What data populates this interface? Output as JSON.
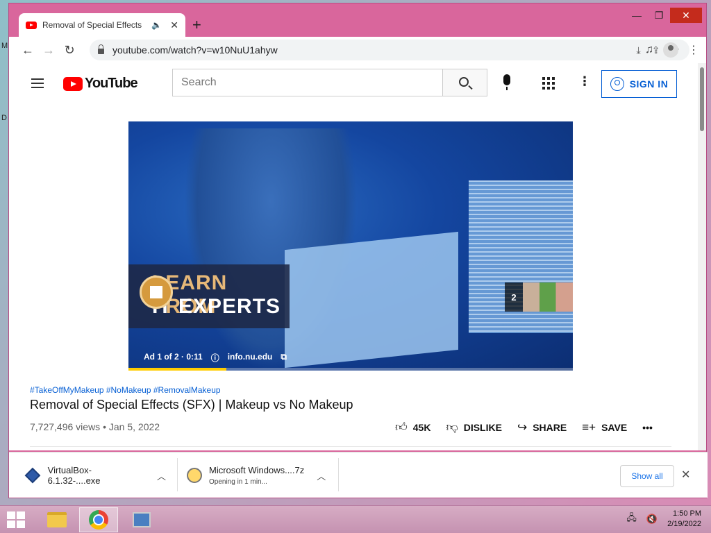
{
  "desktop": {
    "frag_top": "M",
    "frag_mid": "D"
  },
  "browser": {
    "tab_title": "Removal of Special Effects (SFX) | Makeup vs No Makeup",
    "new_tab_label": "+",
    "url": "youtube.com/watch?v=w10NuU1ahyw"
  },
  "youtube": {
    "logo_text": "YouTube",
    "search_placeholder": "Search",
    "sign_in_label": "SIGN IN",
    "ad": {
      "line1": "LEARN FROM",
      "line2": "IT EXPERTS",
      "counter": "2",
      "status": "Ad 1 of 2 · 0:11",
      "info_icon": "ⓘ",
      "advertiser": "info.nu.edu",
      "progress_fraction": 0.22
    },
    "video": {
      "hashtags": "#TakeOffMyMakeup #NoMakeup #RemovalMakeup",
      "title": "Removal of Special Effects (SFX) | Makeup vs No Makeup",
      "views": "7,727,496 views",
      "date": "Jan 5, 2022",
      "meta_sep": " • "
    },
    "actions": {
      "like_count": "45K",
      "dislike_label": "DISLIKE",
      "share_label": "SHARE",
      "save_label": "SAVE",
      "more_label": "•••"
    }
  },
  "downloads": {
    "items": [
      {
        "name": "VirtualBox-6.1.32-....exe",
        "status": ""
      },
      {
        "name": "Microsoft Windows....7z",
        "status": "Opening in 1 min..."
      }
    ],
    "show_all_label": "Show all"
  },
  "taskbar": {
    "time": "1:50 PM",
    "date": "2/19/2022"
  },
  "colors": {
    "window_frame": "#d9669c",
    "youtube_red": "#ff0000",
    "link_blue": "#065fd4",
    "ad_progress": "#ffcc00"
  }
}
